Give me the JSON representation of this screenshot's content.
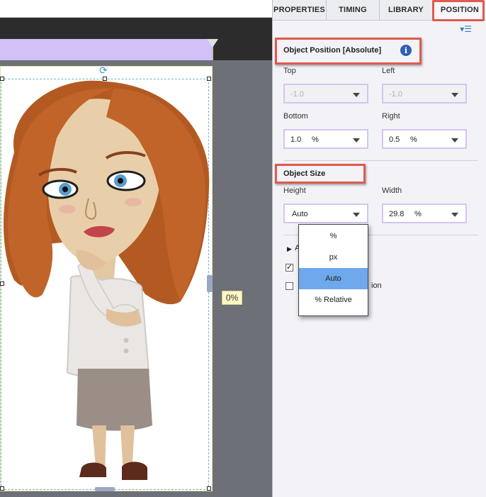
{
  "tabs": [
    {
      "label": "PROPERTIES"
    },
    {
      "label": "TIMING"
    },
    {
      "label": "LIBRARY"
    },
    {
      "label": "POSITION"
    }
  ],
  "stage": {
    "progress_badge": "0%"
  },
  "object_position": {
    "title": "Object Position [Absolute]",
    "top": {
      "label": "Top",
      "value": "-1.0",
      "unit": ""
    },
    "left": {
      "label": "Left",
      "value": "-1.0",
      "unit": ""
    },
    "bottom": {
      "label": "Bottom",
      "value": "1.0",
      "unit": "%"
    },
    "right": {
      "label": "Right",
      "value": "0.5",
      "unit": "%"
    }
  },
  "object_size": {
    "title": "Object Size",
    "height": {
      "label": "Height",
      "value": "Auto"
    },
    "width": {
      "label": "Width",
      "value": "29.8",
      "unit": "%"
    }
  },
  "unit_dropdown": {
    "options": [
      "%",
      "px",
      "Auto",
      "% Relative"
    ],
    "selected": "Auto"
  },
  "advanced": {
    "label_fragment": "A",
    "checkbox1_fragment": "",
    "checkbox2_fragment": "ion"
  },
  "colors": {
    "accent_highlight": "#e05a4d",
    "timeline": "#d2c0f7",
    "dropdown_selected": "#6fa8ec",
    "field_border": "#d5c4ef"
  }
}
